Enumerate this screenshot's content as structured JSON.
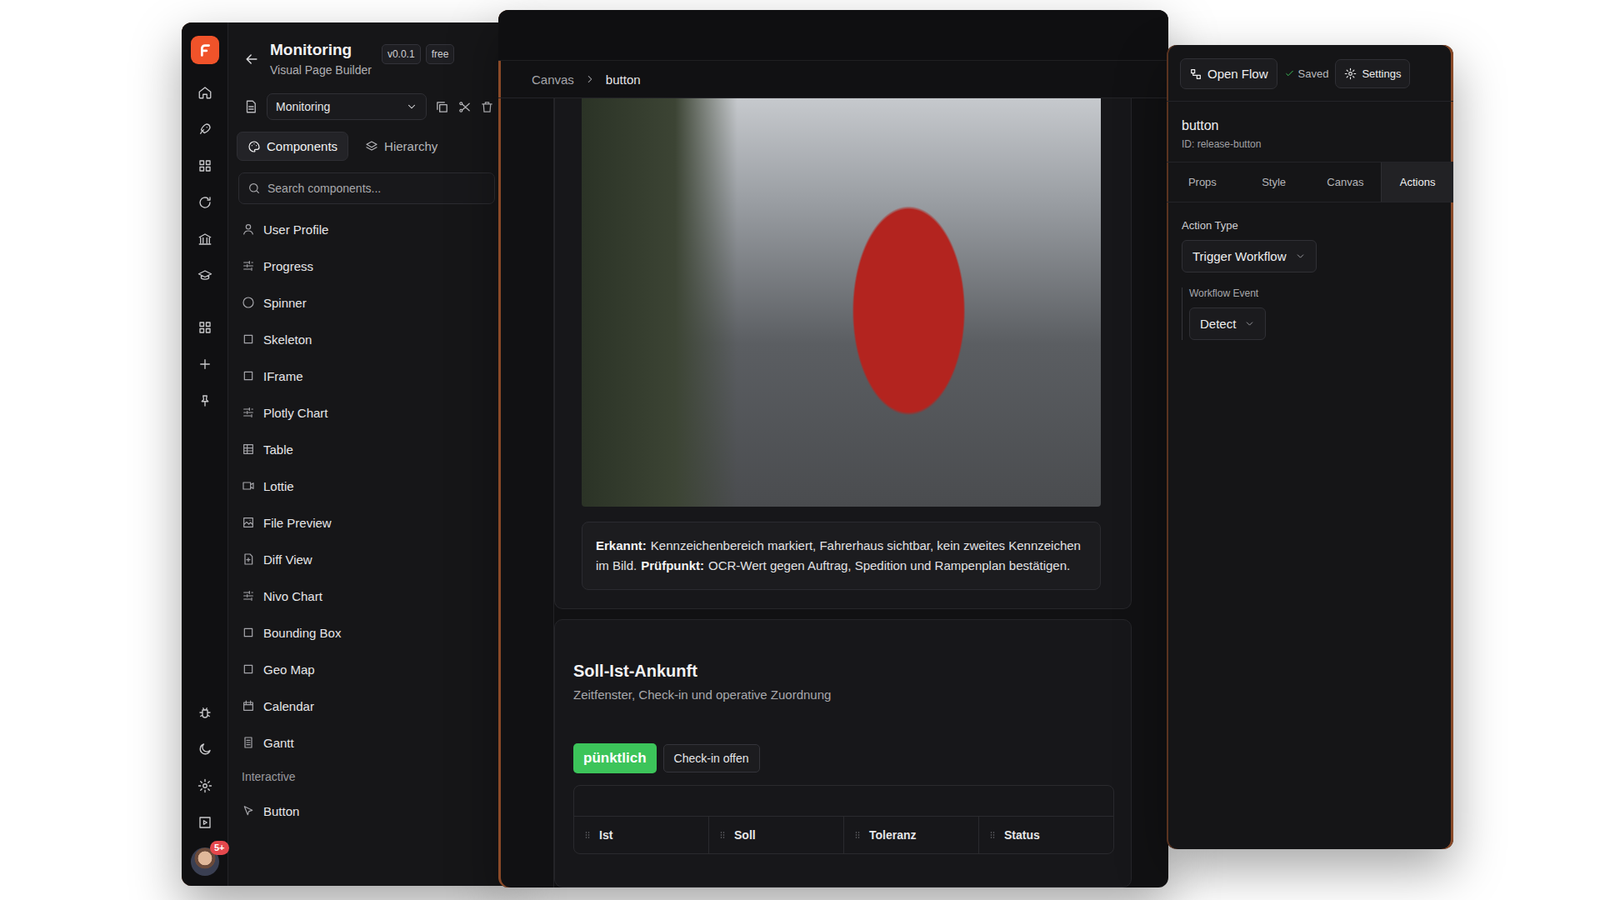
{
  "builder": {
    "notification_badge": "5+",
    "title": "Monitoring",
    "subtitle": "Visual Page Builder",
    "badges": [
      "v0.0.1",
      "free"
    ],
    "page_select": "Monitoring",
    "tabs": [
      {
        "label": "Components",
        "selected": true
      },
      {
        "label": "Hierarchy",
        "selected": false
      }
    ],
    "search": {
      "placeholder": "Search components..."
    },
    "components": [
      {
        "label": "User Profile",
        "kind": "item"
      },
      {
        "label": "Progress",
        "kind": "item"
      },
      {
        "label": "Spinner",
        "kind": "item"
      },
      {
        "label": "Skeleton",
        "kind": "item"
      },
      {
        "label": "IFrame",
        "kind": "item"
      },
      {
        "label": "Plotly Chart",
        "kind": "item"
      },
      {
        "label": "Table",
        "kind": "item"
      },
      {
        "label": "Lottie",
        "kind": "item"
      },
      {
        "label": "File Preview",
        "kind": "item"
      },
      {
        "label": "Diff View",
        "kind": "item"
      },
      {
        "label": "Nivo Chart",
        "kind": "item"
      },
      {
        "label": "Bounding Box",
        "kind": "item"
      },
      {
        "label": "Geo Map",
        "kind": "item"
      },
      {
        "label": "Calendar",
        "kind": "item"
      },
      {
        "label": "Gantt",
        "kind": "item"
      },
      {
        "label": "Interactive",
        "kind": "section"
      },
      {
        "label": "Button",
        "kind": "item"
      }
    ]
  },
  "canvas": {
    "breadcrumb": [
      "Canvas",
      "button"
    ],
    "caption": [
      {
        "label": "Erkannt:",
        "text": "Kennzeichenbereich markiert, Fahrerhaus sichtbar, kein zweites Kennzeichen im Bild."
      },
      {
        "label": "Prüfpunkt:",
        "text": "OCR-Wert gegen Auftrag, Spedition und Rampenplan bestätigen."
      }
    ],
    "card": {
      "title": "Soll-Ist-Ankunft",
      "subtitle": "Zeitfenster, Check-in und operative Zuordnung",
      "badges": [
        {
          "label": "pünktlich",
          "kind": "success"
        },
        {
          "label": "Check-in offen",
          "kind": "outline"
        }
      ],
      "table": {
        "columns": [
          "Ist",
          "Soll",
          "Toleranz",
          "Status"
        ]
      }
    }
  },
  "inspector": {
    "open_flow": "Open Flow",
    "saved": "Saved",
    "settings": "Settings",
    "element": {
      "name": "button",
      "id": "ID: release-button"
    },
    "tabs": [
      {
        "label": "Props",
        "selected": false
      },
      {
        "label": "Style",
        "selected": false
      },
      {
        "label": "Canvas",
        "selected": false
      },
      {
        "label": "Actions",
        "selected": true
      }
    ],
    "action_type": {
      "label": "Action Type",
      "value": "Trigger Workflow"
    },
    "workflow_event": {
      "label": "Workflow Event",
      "value": "Detect"
    }
  }
}
